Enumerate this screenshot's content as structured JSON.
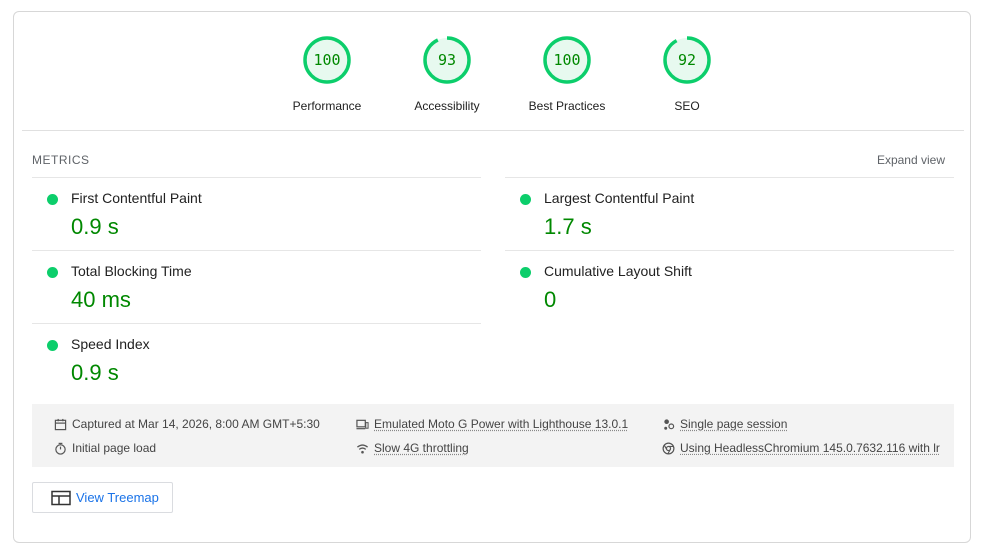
{
  "gauges": [
    {
      "score": "100",
      "label": "Performance",
      "fraction": 1.0
    },
    {
      "score": "93",
      "label": "Accessibility",
      "fraction": 0.93
    },
    {
      "score": "100",
      "label": "Best Practices",
      "fraction": 1.0
    },
    {
      "score": "92",
      "label": "SEO",
      "fraction": 0.92
    }
  ],
  "colors": {
    "pass": "#0cce6b",
    "value": "#008800",
    "link": "#1a73e8"
  },
  "metrics": {
    "title": "METRICS",
    "expand_label": "Expand view",
    "items": [
      {
        "label": "First Contentful Paint",
        "value": "0.9 s"
      },
      {
        "label": "Largest Contentful Paint",
        "value": "1.7 s"
      },
      {
        "label": "Total Blocking Time",
        "value": "40 ms"
      },
      {
        "label": "Cumulative Layout Shift",
        "value": "0"
      },
      {
        "label": "Speed Index",
        "value": "0.9 s"
      }
    ]
  },
  "environment": {
    "captured": "Captured at Mar 14, 2026, 8:00 AM GMT+5:30",
    "initial_load": "Initial page load",
    "device": "Emulated Moto G Power with Lighthouse 13.0.1",
    "throttling": "Slow 4G throttling",
    "session": "Single page session",
    "browser": "Using HeadlessChromium 145.0.7632.116 with lr"
  },
  "treemap_label": "View Treemap"
}
